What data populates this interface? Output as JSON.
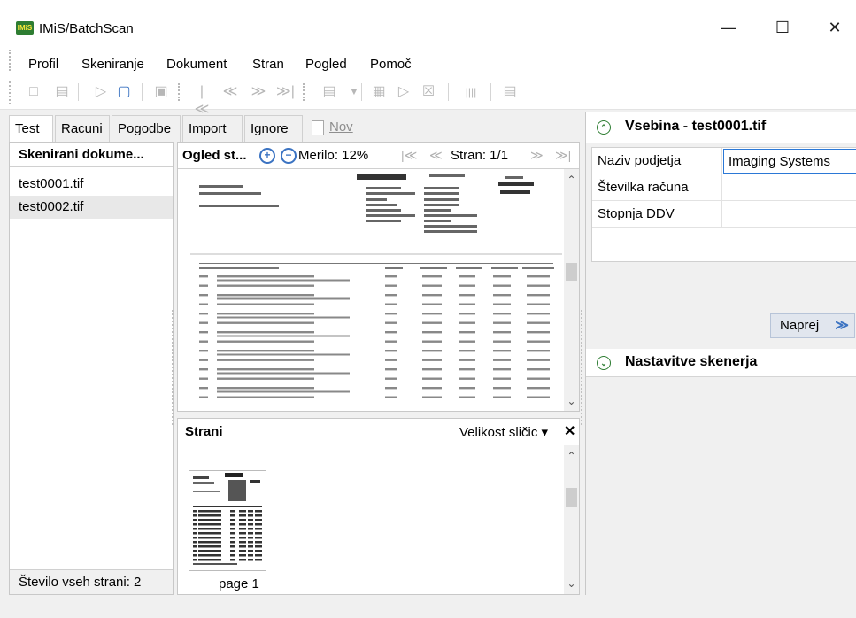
{
  "window": {
    "title": "IMiS/BatchScan",
    "icon_text": "IMiS",
    "minimize": "—",
    "maximize": "☐",
    "close": "✕"
  },
  "menu": [
    "Profil",
    "Skeniranje",
    "Dokument",
    "Stran",
    "Pogled",
    "Pomoč"
  ],
  "tabs": {
    "items": [
      "Test",
      "Racuni",
      "Pogodbe",
      "Import",
      "Ignore"
    ],
    "new_label": "Nov",
    "active": "Test"
  },
  "files": {
    "header": "Skenirani dokume...",
    "items": [
      "test0001.tif",
      "test0002.tif"
    ],
    "footer": "Število vseh strani: 2"
  },
  "preview": {
    "title": "Ogled st...",
    "zoom_in": "+",
    "zoom_out": "−",
    "merilo": "Merilo: 12%",
    "first": "|≪",
    "prev": "≪",
    "strani": "Stran: 1/1",
    "next": "≫",
    "last": "≫|"
  },
  "strani": {
    "title": "Strani",
    "velikost": "Velikost sličic ▾",
    "close": "✕",
    "page_label": "page 1"
  },
  "vsebina": {
    "header": "Vsebina - test0001.tif",
    "header_icon": "⌃",
    "fields": [
      {
        "label": "Naziv podjetja",
        "value": "Imaging Systems"
      },
      {
        "label": "Številka računa",
        "value": ""
      },
      {
        "label": "Stopnja DDV",
        "value": ""
      }
    ],
    "button": "Naprej",
    "button_icon": "≫"
  },
  "nastavitve": {
    "header": "Nastavitve skenerja",
    "header_icon": "⌄"
  }
}
